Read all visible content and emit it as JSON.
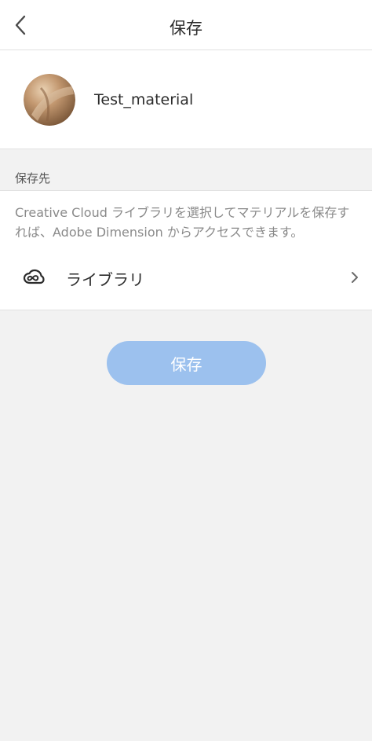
{
  "header": {
    "title": "保存",
    "back_icon": "chevron-left-icon"
  },
  "material": {
    "name": "Test_material",
    "thumbnail_icon": "material-sphere-thumbnail"
  },
  "destination": {
    "section_label": "保存先",
    "description": "Creative Cloud ライブラリを選択してマテリアルを保存すれば、Adobe Dimension からアクセスできます。",
    "library": {
      "icon": "creative-cloud-icon",
      "label": "ライブラリ",
      "chevron_icon": "chevron-right-icon"
    }
  },
  "actions": {
    "save_label": "保存",
    "save_color": "#9cc1ee"
  },
  "colors": {
    "background": "#f2f2f2",
    "surface": "#ffffff",
    "divider": "#e1e1e1",
    "muted_text": "#8a8a8a"
  }
}
